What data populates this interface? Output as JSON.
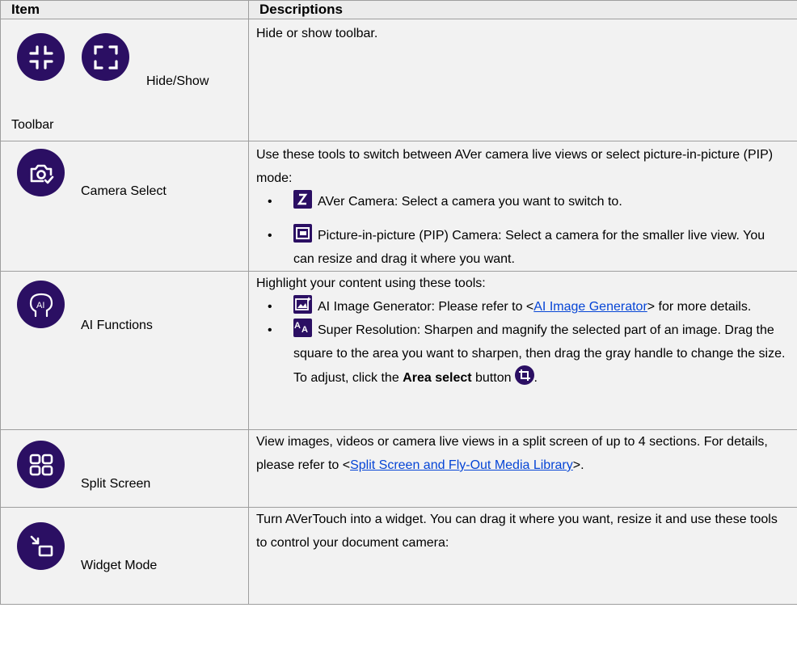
{
  "header": {
    "item": "Item",
    "descriptions": "Descriptions"
  },
  "rows": [
    {
      "item_label": "Hide/Show",
      "item_label_2": "Toolbar",
      "desc": "Hide or show toolbar."
    },
    {
      "item_label": "Camera Select",
      "desc": "Use these tools to switch between AVer camera live views or select picture-in-picture (PIP) mode:",
      "bullets": [
        "AVer Camera: Select a camera you want to switch to.",
        "Picture-in-picture (PIP) Camera: Select a camera for the smaller live view. You can resize and drag it where you want."
      ]
    },
    {
      "item_label": "AI Functions",
      "desc": "Highlight your content using these tools:",
      "b1_pre": "AI Image Generator: Please refer to <",
      "b1_link": "AI Image Generator",
      "b1_post": "> for more details.",
      "b2_text": "Super Resolution: Sharpen and magnify the selected part of an image. Drag the square to the area you want to sharpen, then drag the gray handle to change the size. To adjust, click the ",
      "b2_bold": "Area select",
      "b2_after": " button",
      "b2_end": "."
    },
    {
      "item_label": "Split Screen",
      "desc_pre": "View images, videos or camera live views in a split screen of up to 4 sections. For details, please refer to <",
      "desc_link": "Split Screen and Fly-Out Media Library",
      "desc_post": ">."
    },
    {
      "item_label": "Widget Mode",
      "desc": "Turn AVerTouch into a widget. You can drag it where you want, resize it and use these tools to control your document camera:"
    }
  ],
  "icons": {
    "row1_a": "collapse-corners-icon",
    "row1_b": "expand-corners-icon",
    "row2": "camera-check-icon",
    "row3": "ai-head-icon",
    "row4": "split-grid-icon",
    "row5": "widget-arrow-icon",
    "accent": "#2b0f63",
    "link": "#0645d6"
  }
}
